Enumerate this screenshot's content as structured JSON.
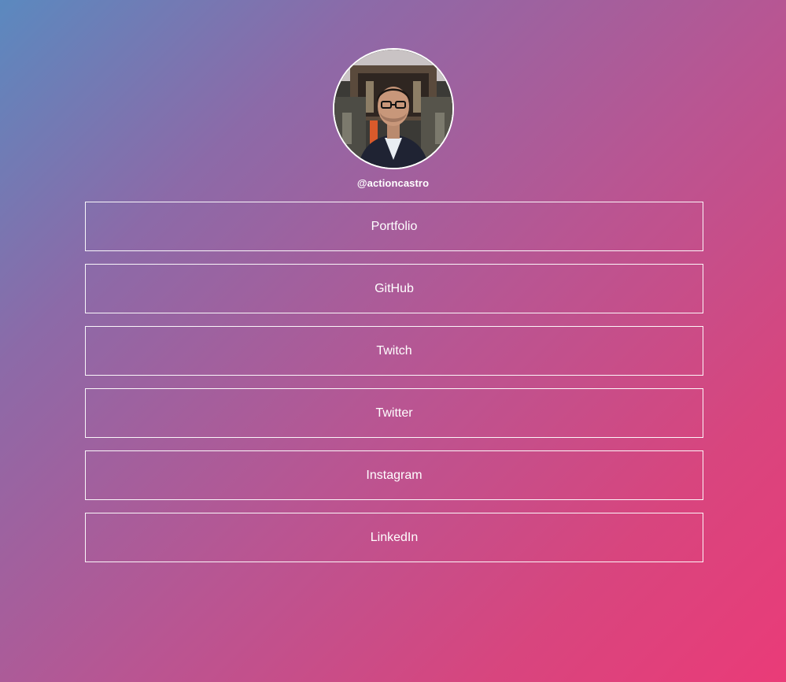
{
  "profile": {
    "handle": "@actioncastro",
    "avatar_icon": "profile-photo"
  },
  "links": [
    {
      "label": "Portfolio"
    },
    {
      "label": "GitHub"
    },
    {
      "label": "Twitch"
    },
    {
      "label": "Twitter"
    },
    {
      "label": "Instagram"
    },
    {
      "label": "LinkedIn"
    }
  ],
  "colors": {
    "gradient_start": "#5b89bf",
    "gradient_end": "#ea3b78",
    "text": "#ffffff"
  }
}
